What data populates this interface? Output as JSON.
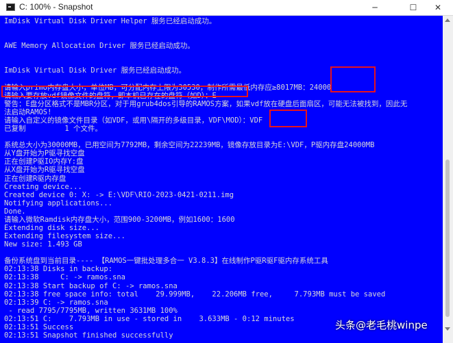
{
  "window": {
    "title": "C: 100% - Snapshot",
    "icons": [
      "console-icon",
      "minimize-icon",
      "maximize-icon",
      "close-icon"
    ],
    "minimize_glyph": "─",
    "maximize_glyph": "☐",
    "close_glyph": "✕"
  },
  "console": {
    "background": "#0000ff",
    "text_color": "#d8d8d8",
    "highlight_color": "#e8141c",
    "lines": [
      "ImDisk Virtual Disk Driver Helper 服务已经启动成功。",
      "",
      "",
      "AWE Memory Allocation Driver 服务已经启动成功。",
      "",
      "",
      "ImDisk Virtual Disk Driver 服务已经启动成功。",
      "",
      "请输入primo内存盘大小，单位MB，可分配内存上限为30530，制作所需最低内存应≥8017MB：24000",
      "请输入要存放vdf镜像文件的盘符，即本机已存在的盘符（如D）：E",
      "警告：E盘分区格式不是MBR分区，对于用grub4dos引导的RAMOS方案，如果vdf放在硬盘后面扇区，可能无法被找到，因此无",
      "法启动RAMOS!",
      "请输入自定义的镜像文件目录（如VDF，或用\\隔开的多级目录，VDF\\MOD）：VDF",
      "已复制         1 个文件。",
      "",
      "系统总大小为30000MB，已用空间为7792MB，剩余空间为22239MB，镜像存放目录为E:\\VDF，P驱内存盘24000MB",
      "从Y盘开始为P驱寻找空盘",
      "正在创建P驱IO内存Y:盘",
      "从X盘开始为R驱寻找空盘",
      "正在创建R驱内存盘",
      "Creating device...",
      "Created device 0: X: -> E:\\VDF\\RIO-2023-0421-0211.img",
      "Notifying applications...",
      "Done.",
      "请输入微软Ramdisk内存盘大小，范围900-3200MB，例如1600：1600",
      "Extending disk size...",
      "Extending filesystem size...",
      "New size: 1.493 GB",
      "",
      "备份系统盘到当前目录---- 【RAMOS一键批处理多合一 V3.8.3】在线制作P驱R驱F驱内存系统工具",
      "02:13:38 Disks in backup:",
      "02:13:38     C: -> ramos.sna",
      "02:13:38 Start backup of C: -> ramos.sna",
      "02:13:38 free space info: total    29.999MB,    22.206MB free,     7.793MB must be saved",
      "02:13:39 C: -> ramos.sna",
      " - read 7795/7795MB, written 3631MB 100%",
      "02:13:51 C:    7.793MB in use - stored in    3.633MB - 0:12 minutes",
      "02:13:51 Success",
      "02:13:51 Snapshot finished successfully"
    ]
  },
  "watermark": {
    "logo": "头条",
    "handle": "@老毛桃winpe"
  }
}
